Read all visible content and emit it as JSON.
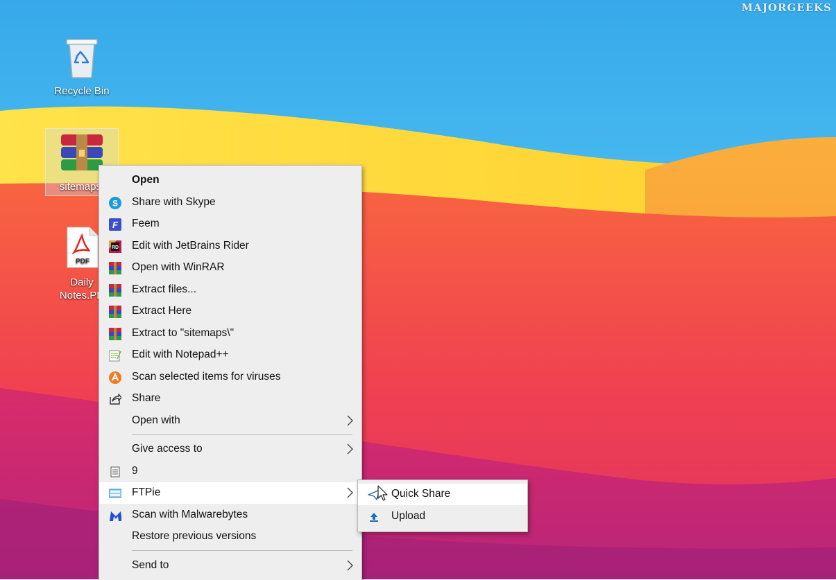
{
  "watermark": "MAJORGEEKS",
  "desktop": {
    "icons": [
      {
        "label": "Recycle Bin",
        "icon": "recycle-bin-icon"
      },
      {
        "label": "sitemaps.",
        "icon": "winrar-archive-icon"
      },
      {
        "label_line1": "Daily",
        "label_line2": "Notes.PD",
        "icon": "pdf-icon",
        "badge": "PDF"
      }
    ]
  },
  "context_menu": {
    "items": [
      {
        "label": "Open",
        "icon": ""
      },
      {
        "label": "Share with Skype",
        "icon": "skype-icon"
      },
      {
        "label": "Feem",
        "icon": "feem-icon"
      },
      {
        "label": "Edit with JetBrains Rider",
        "icon": "jetbrains-rider-icon",
        "icon_text": "RD"
      },
      {
        "label": "Open with WinRAR",
        "icon": "winrar-icon"
      },
      {
        "label": "Extract files...",
        "icon": "winrar-icon"
      },
      {
        "label": "Extract Here",
        "icon": "winrar-icon"
      },
      {
        "label": "Extract to \"sitemaps\\\"",
        "icon": "winrar-icon"
      },
      {
        "label": "Edit with Notepad++",
        "icon": "notepad-plus-plus-icon"
      },
      {
        "label": "Scan selected items for viruses",
        "icon": "avast-icon"
      },
      {
        "label": "Share",
        "icon": "share-icon"
      },
      {
        "label": "Open with",
        "icon": "",
        "submenu": true
      },
      {
        "label": "Give access to",
        "icon": "",
        "submenu": true
      },
      {
        "label": "9",
        "icon": "document-lines-icon"
      },
      {
        "label": "FTPie",
        "icon": "ftpie-icon",
        "submenu": true,
        "highlighted": true
      },
      {
        "label": "Scan with Malwarebytes",
        "icon": "malwarebytes-icon"
      },
      {
        "label": "Restore previous versions",
        "icon": ""
      },
      {
        "label": "Send to",
        "icon": "",
        "submenu": true
      }
    ]
  },
  "ftpie_submenu": {
    "items": [
      {
        "label": "Quick Share",
        "icon": "quick-share-icon",
        "highlighted": true
      },
      {
        "label": "Upload",
        "icon": "upload-arrow-icon"
      }
    ]
  },
  "colors": {
    "sky": "#3fb8f0",
    "yellow": "#ffd93a",
    "orange": "#fb9a35",
    "red": "#f0464d",
    "magenta": "#d72a6c",
    "menu_bg": "#eeeeee",
    "menu_highlight": "#ffffff"
  }
}
